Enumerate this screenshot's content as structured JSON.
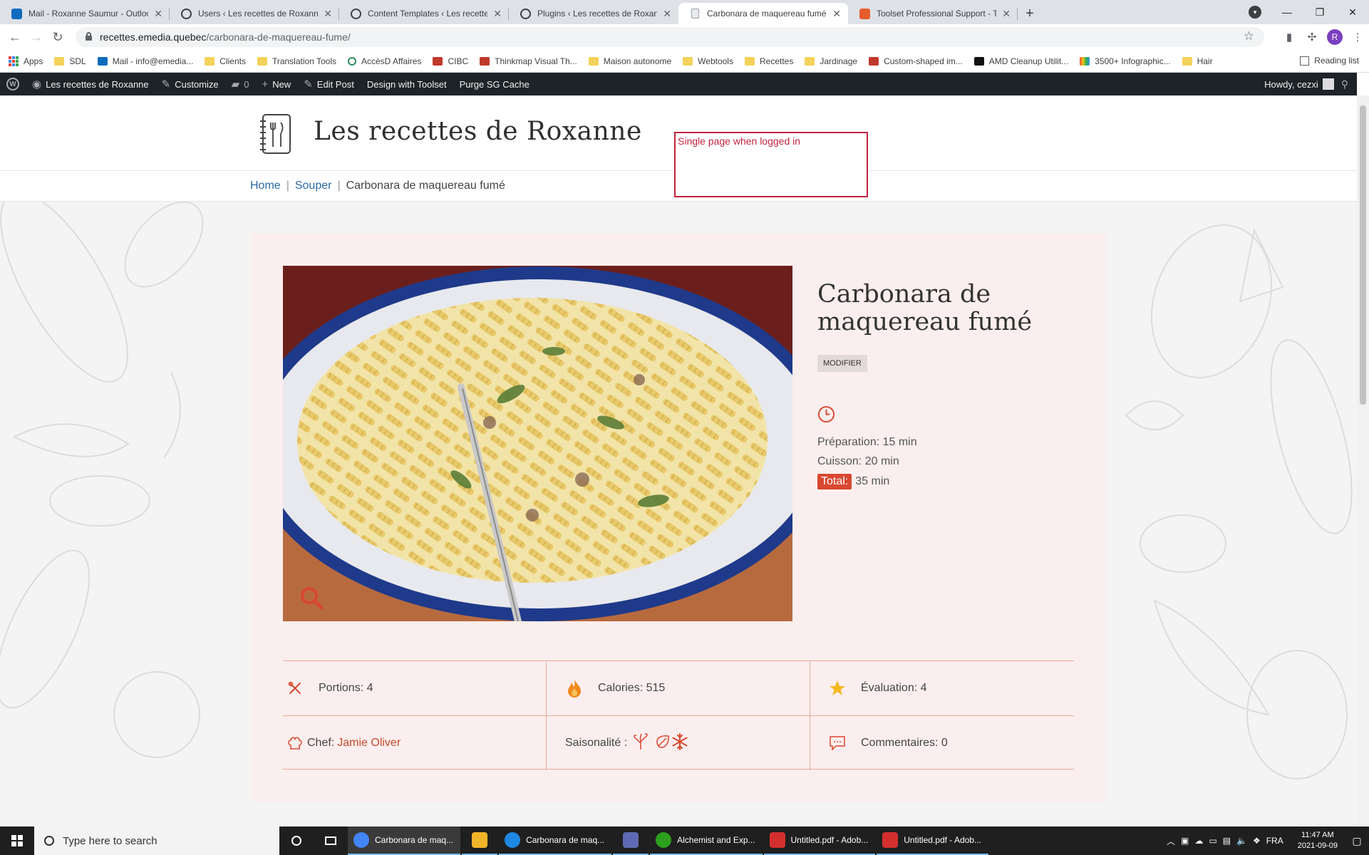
{
  "browser": {
    "tabs": [
      {
        "label": "Mail - Roxanne Saumur - Outlook",
        "icon": "outlook-icon",
        "color": "#0f6cbd"
      },
      {
        "label": "Users ‹ Les recettes de Roxanne —",
        "icon": "wordpress-icon",
        "color": "#3c4043"
      },
      {
        "label": "Content Templates ‹ Les recettes",
        "icon": "wordpress-icon",
        "color": "#3c4043"
      },
      {
        "label": "Plugins ‹ Les recettes de Roxanne",
        "icon": "wordpress-icon",
        "color": "#3c4043"
      },
      {
        "label": "Carbonara de maquereau fumé –",
        "icon": "page-icon",
        "color": "#9aa0a6",
        "active": true
      },
      {
        "label": "Toolset Professional Support - To",
        "icon": "toolset-icon",
        "color": "#e65c2b"
      }
    ],
    "url_host": "recettes.emedia.quebec",
    "url_path": "/carbonara-de-maquereau-fume/",
    "profile_initial": "R",
    "bookmarks": [
      {
        "label": "Apps",
        "icon": "apps"
      },
      {
        "label": "SDL",
        "icon": "folder"
      },
      {
        "label": "Mail - info@emedia...",
        "icon": "outlook"
      },
      {
        "label": "Clients",
        "icon": "folder"
      },
      {
        "label": "Translation Tools",
        "icon": "folder"
      },
      {
        "label": "AccèsD Affaires",
        "icon": "circle"
      },
      {
        "label": "CIBC",
        "icon": "red"
      },
      {
        "label": "Thinkmap Visual Th...",
        "icon": "red"
      },
      {
        "label": "Maison autonome",
        "icon": "folder"
      },
      {
        "label": "Webtools",
        "icon": "folder"
      },
      {
        "label": "Recettes",
        "icon": "folder"
      },
      {
        "label": "Jardinage",
        "icon": "folder"
      },
      {
        "label": "Custom-shaped im...",
        "icon": "red"
      },
      {
        "label": "AMD Cleanup Utilit...",
        "icon": "dark"
      },
      {
        "label": "3500+ Infographic...",
        "icon": "multi"
      },
      {
        "label": "Hair",
        "icon": "folder"
      }
    ],
    "reading_list": "Reading list"
  },
  "adminbar": {
    "site_name": "Les recettes de Roxanne",
    "customize": "Customize",
    "comments_count": "0",
    "new": "New",
    "edit_post": "Edit Post",
    "design_toolset": "Design with Toolset",
    "purge_cache": "Purge SG Cache",
    "howdy": "Howdy, cezxi"
  },
  "site": {
    "title": "Les recettes de Roxanne",
    "note": "Single page when logged in"
  },
  "breadcrumb": {
    "home": "Home",
    "category": "Souper",
    "current": "Carbonara de maquereau fumé",
    "separator": "|"
  },
  "recipe": {
    "title": "Carbonara de maquereau fumé",
    "modifier_label": "MODIFIER",
    "preparation": "Préparation: 15 min",
    "cuisson": "Cuisson: 20 min",
    "total_label": "Total:",
    "total_value": "35 min",
    "portions": "Portions: 4",
    "calories": "Calories: 515",
    "evaluation": "Évaluation: 4",
    "chef_label": "Chef:",
    "chef_name": "Jamie Oliver",
    "saisonalite": "Saisonalité :",
    "commentaires": "Commentaires: 0",
    "accent_color": "#d9472f"
  },
  "taskbar": {
    "search_placeholder": "Type here to search",
    "apps": [
      {
        "label": "Carbonara de maq...",
        "color": "#4285f4",
        "active": true
      },
      {
        "label": "",
        "color": "#f0b429"
      },
      {
        "label": "Carbonara de maq...",
        "color": "#1e88e5"
      },
      {
        "label": "",
        "color": "#5f6ab4"
      },
      {
        "label": "Alchemist and Exp...",
        "color": "#2ca01c"
      },
      {
        "label": "Untitled.pdf - Adob...",
        "color": "#d32f2f"
      },
      {
        "label": "Untitled.pdf - Adob...",
        "color": "#d32f2f"
      }
    ],
    "language": "FRA",
    "time": "11:47 AM",
    "date": "2021-09-09"
  }
}
